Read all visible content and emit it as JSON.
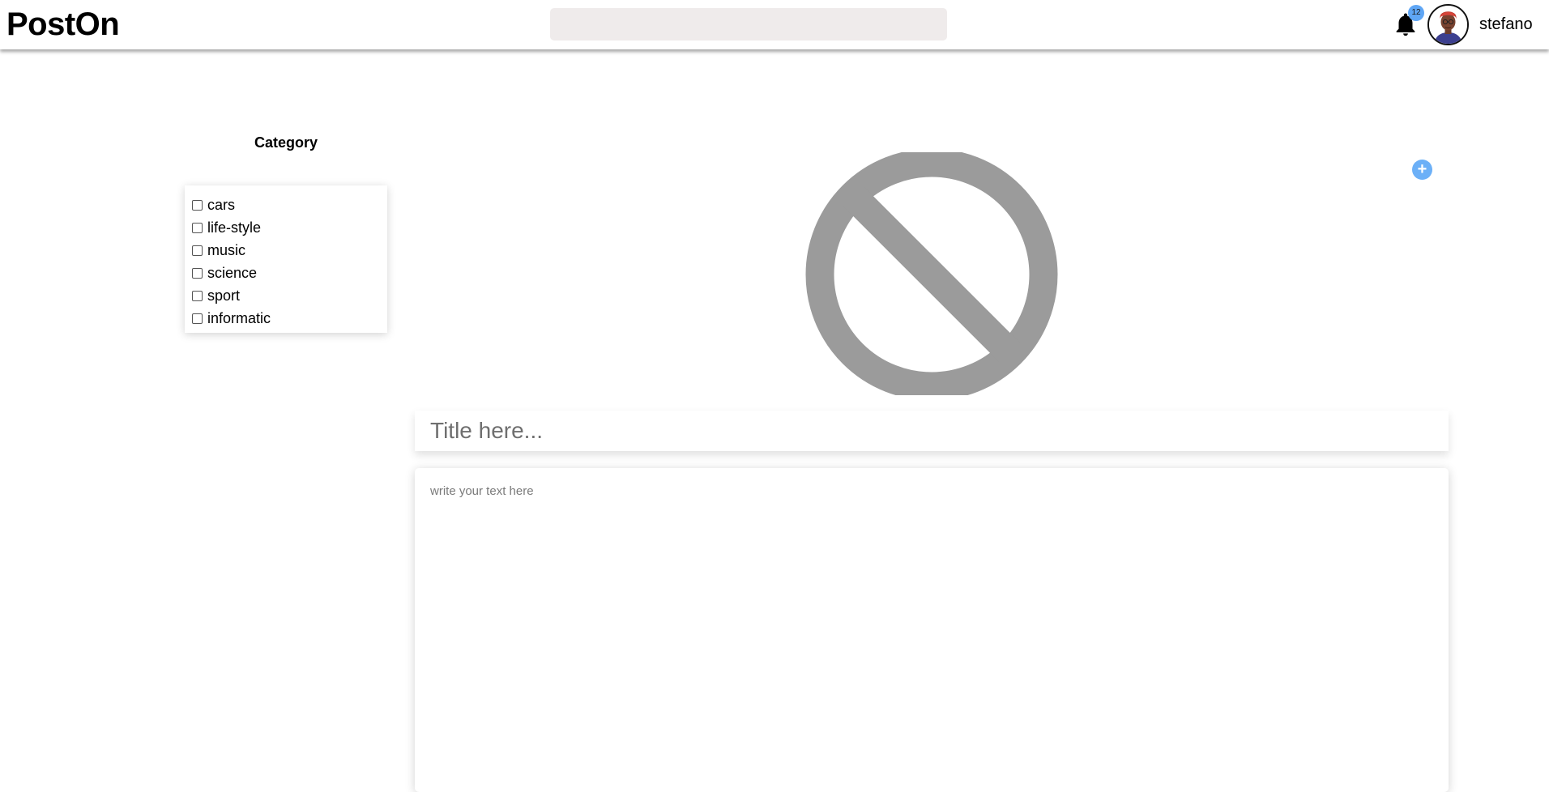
{
  "header": {
    "logo": "PostOn",
    "search": {
      "placeholder": "",
      "value": ""
    },
    "notifications": {
      "icon": "bell-icon",
      "count": "12"
    },
    "user": {
      "avatar_icon": "user-avatar",
      "name": "stefano"
    }
  },
  "sidebar": {
    "title": "Category",
    "categories": [
      {
        "label": "cars",
        "checked": false
      },
      {
        "label": "life-style",
        "checked": false
      },
      {
        "label": "music",
        "checked": false
      },
      {
        "label": "science",
        "checked": false
      },
      {
        "label": "sport",
        "checked": false
      },
      {
        "label": "informatic",
        "checked": false
      }
    ]
  },
  "editor": {
    "image_placeholder_icon": "no-image-icon",
    "add_image_icon": "plus-icon",
    "add_image_label": "+",
    "title_placeholder": "Title here...",
    "text_placeholder": "write your text here"
  },
  "colors": {
    "accent": "#6cb0f7",
    "badge": "#5fa6f5",
    "search_bg": "#efebeb",
    "placeholder_icon": "#9b9b9b"
  }
}
